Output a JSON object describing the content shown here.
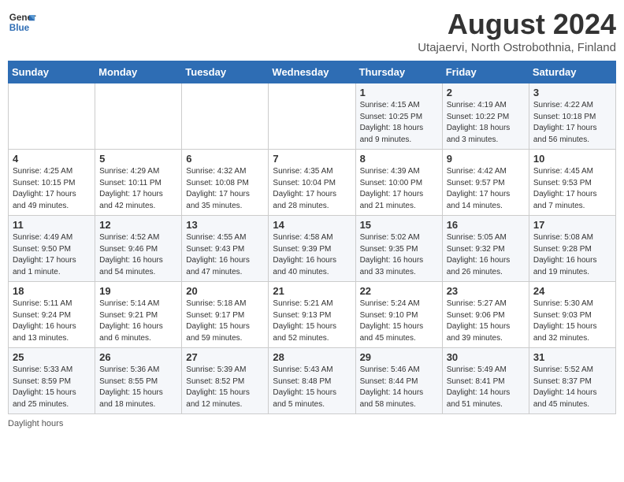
{
  "header": {
    "logo_general": "General",
    "logo_blue": "Blue",
    "title": "August 2024",
    "subtitle": "Utajaervi, North Ostrobothnia, Finland"
  },
  "days_of_week": [
    "Sunday",
    "Monday",
    "Tuesday",
    "Wednesday",
    "Thursday",
    "Friday",
    "Saturday"
  ],
  "weeks": [
    [
      {
        "day": "",
        "info": ""
      },
      {
        "day": "",
        "info": ""
      },
      {
        "day": "",
        "info": ""
      },
      {
        "day": "",
        "info": ""
      },
      {
        "day": "1",
        "info": "Sunrise: 4:15 AM\nSunset: 10:25 PM\nDaylight: 18 hours\nand 9 minutes."
      },
      {
        "day": "2",
        "info": "Sunrise: 4:19 AM\nSunset: 10:22 PM\nDaylight: 18 hours\nand 3 minutes."
      },
      {
        "day": "3",
        "info": "Sunrise: 4:22 AM\nSunset: 10:18 PM\nDaylight: 17 hours\nand 56 minutes."
      }
    ],
    [
      {
        "day": "4",
        "info": "Sunrise: 4:25 AM\nSunset: 10:15 PM\nDaylight: 17 hours\nand 49 minutes."
      },
      {
        "day": "5",
        "info": "Sunrise: 4:29 AM\nSunset: 10:11 PM\nDaylight: 17 hours\nand 42 minutes."
      },
      {
        "day": "6",
        "info": "Sunrise: 4:32 AM\nSunset: 10:08 PM\nDaylight: 17 hours\nand 35 minutes."
      },
      {
        "day": "7",
        "info": "Sunrise: 4:35 AM\nSunset: 10:04 PM\nDaylight: 17 hours\nand 28 minutes."
      },
      {
        "day": "8",
        "info": "Sunrise: 4:39 AM\nSunset: 10:00 PM\nDaylight: 17 hours\nand 21 minutes."
      },
      {
        "day": "9",
        "info": "Sunrise: 4:42 AM\nSunset: 9:57 PM\nDaylight: 17 hours\nand 14 minutes."
      },
      {
        "day": "10",
        "info": "Sunrise: 4:45 AM\nSunset: 9:53 PM\nDaylight: 17 hours\nand 7 minutes."
      }
    ],
    [
      {
        "day": "11",
        "info": "Sunrise: 4:49 AM\nSunset: 9:50 PM\nDaylight: 17 hours\nand 1 minute."
      },
      {
        "day": "12",
        "info": "Sunrise: 4:52 AM\nSunset: 9:46 PM\nDaylight: 16 hours\nand 54 minutes."
      },
      {
        "day": "13",
        "info": "Sunrise: 4:55 AM\nSunset: 9:43 PM\nDaylight: 16 hours\nand 47 minutes."
      },
      {
        "day": "14",
        "info": "Sunrise: 4:58 AM\nSunset: 9:39 PM\nDaylight: 16 hours\nand 40 minutes."
      },
      {
        "day": "15",
        "info": "Sunrise: 5:02 AM\nSunset: 9:35 PM\nDaylight: 16 hours\nand 33 minutes."
      },
      {
        "day": "16",
        "info": "Sunrise: 5:05 AM\nSunset: 9:32 PM\nDaylight: 16 hours\nand 26 minutes."
      },
      {
        "day": "17",
        "info": "Sunrise: 5:08 AM\nSunset: 9:28 PM\nDaylight: 16 hours\nand 19 minutes."
      }
    ],
    [
      {
        "day": "18",
        "info": "Sunrise: 5:11 AM\nSunset: 9:24 PM\nDaylight: 16 hours\nand 13 minutes."
      },
      {
        "day": "19",
        "info": "Sunrise: 5:14 AM\nSunset: 9:21 PM\nDaylight: 16 hours\nand 6 minutes."
      },
      {
        "day": "20",
        "info": "Sunrise: 5:18 AM\nSunset: 9:17 PM\nDaylight: 15 hours\nand 59 minutes."
      },
      {
        "day": "21",
        "info": "Sunrise: 5:21 AM\nSunset: 9:13 PM\nDaylight: 15 hours\nand 52 minutes."
      },
      {
        "day": "22",
        "info": "Sunrise: 5:24 AM\nSunset: 9:10 PM\nDaylight: 15 hours\nand 45 minutes."
      },
      {
        "day": "23",
        "info": "Sunrise: 5:27 AM\nSunset: 9:06 PM\nDaylight: 15 hours\nand 39 minutes."
      },
      {
        "day": "24",
        "info": "Sunrise: 5:30 AM\nSunset: 9:03 PM\nDaylight: 15 hours\nand 32 minutes."
      }
    ],
    [
      {
        "day": "25",
        "info": "Sunrise: 5:33 AM\nSunset: 8:59 PM\nDaylight: 15 hours\nand 25 minutes."
      },
      {
        "day": "26",
        "info": "Sunrise: 5:36 AM\nSunset: 8:55 PM\nDaylight: 15 hours\nand 18 minutes."
      },
      {
        "day": "27",
        "info": "Sunrise: 5:39 AM\nSunset: 8:52 PM\nDaylight: 15 hours\nand 12 minutes."
      },
      {
        "day": "28",
        "info": "Sunrise: 5:43 AM\nSunset: 8:48 PM\nDaylight: 15 hours\nand 5 minutes."
      },
      {
        "day": "29",
        "info": "Sunrise: 5:46 AM\nSunset: 8:44 PM\nDaylight: 14 hours\nand 58 minutes."
      },
      {
        "day": "30",
        "info": "Sunrise: 5:49 AM\nSunset: 8:41 PM\nDaylight: 14 hours\nand 51 minutes."
      },
      {
        "day": "31",
        "info": "Sunrise: 5:52 AM\nSunset: 8:37 PM\nDaylight: 14 hours\nand 45 minutes."
      }
    ]
  ],
  "footer": {
    "daylight_label": "Daylight hours"
  }
}
